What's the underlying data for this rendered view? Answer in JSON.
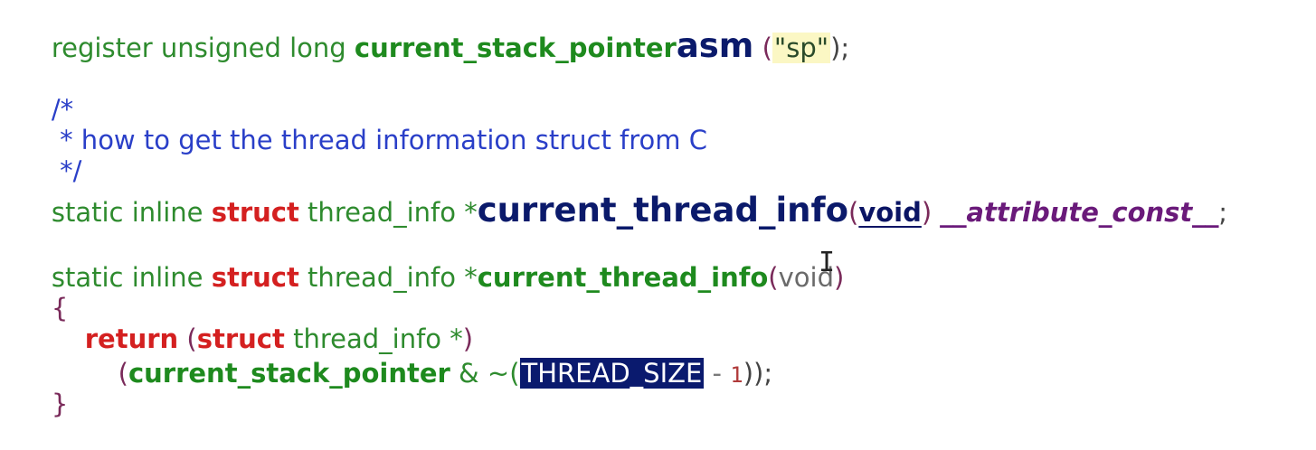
{
  "code": {
    "l1": {
      "prefix": "register unsigned long ",
      "var": "current_stack_pointer",
      "asm": "asm",
      "open": " (",
      "str": "\"sp\"",
      "close": ");"
    },
    "l2": {
      "text": "/*"
    },
    "l3": {
      "text": " * how to get the thread information struct from C"
    },
    "l4": {
      "text": " */"
    },
    "l5": {
      "prefix": "static inline ",
      "kw": "struct",
      "type": " thread_info *",
      "fn": "current_thread_info",
      "open": "(",
      "arg": "void",
      "close": ") ",
      "attr": "__attribute_const__",
      "semi": ";"
    },
    "l6": {
      "prefix": "static inline ",
      "kw": "struct",
      "type": " thread_info *",
      "fn": "current_thread_info",
      "open": "(",
      "arg": "void",
      "close": ")"
    },
    "l7": {
      "text": "{"
    },
    "l8": {
      "indent": "    ",
      "kw": "return",
      "open": " (",
      "kw2": "struct",
      "type": " thread_info *",
      "close": ")"
    },
    "l9": {
      "indent": "        ",
      "open": "(",
      "var": "current_stack_pointer",
      "op": " & ~(",
      "sel": "THREAD_SIZE",
      "minus": " - ",
      "num": "1",
      "close": "));"
    },
    "l10": {
      "text": "}"
    }
  },
  "cursor": {
    "glyph": "I"
  }
}
